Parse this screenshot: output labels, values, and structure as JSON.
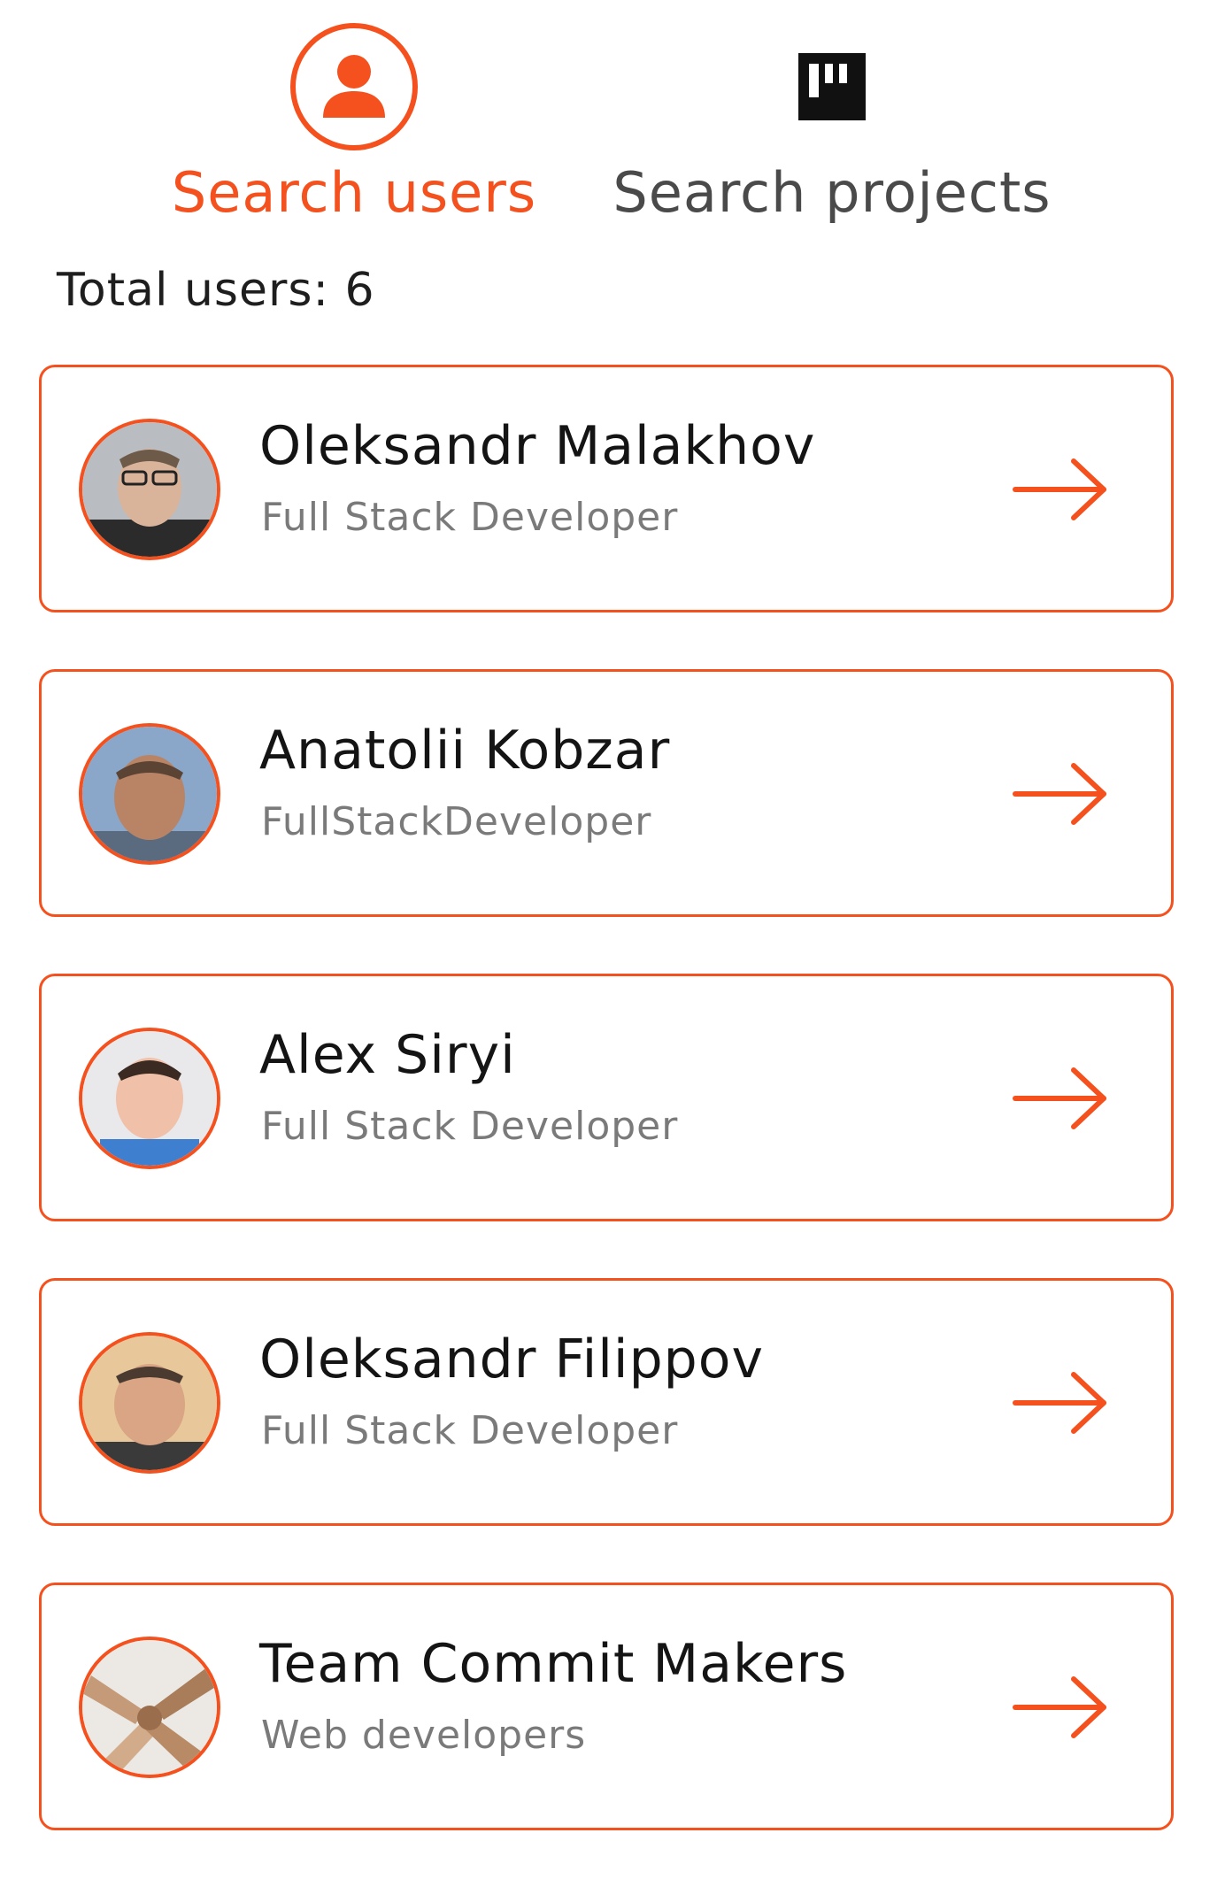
{
  "tabs": {
    "users": {
      "label": "Search users",
      "icon": "user-icon",
      "active": true
    },
    "projects": {
      "label": "Search projects",
      "icon": "board-icon",
      "active": false
    }
  },
  "total_label": "Total users: 6",
  "colors": {
    "accent": "#f4511e",
    "text": "#141414",
    "muted": "#7a7a7a"
  },
  "users": [
    {
      "name": "Oleksandr Malakhov",
      "role": "Full Stack Developer",
      "avatar": "avatar-photo"
    },
    {
      "name": "Anatolii Kobzar",
      "role": "FullStackDeveloper",
      "avatar": "avatar-photo"
    },
    {
      "name": "Alex Siryi",
      "role": "Full Stack Developer",
      "avatar": "avatar-photo"
    },
    {
      "name": "Oleksandr Filippov",
      "role": "Full Stack Developer",
      "avatar": "avatar-photo"
    },
    {
      "name": "Team Commit Makers",
      "role": "Web developers",
      "avatar": "avatar-photo"
    }
  ]
}
